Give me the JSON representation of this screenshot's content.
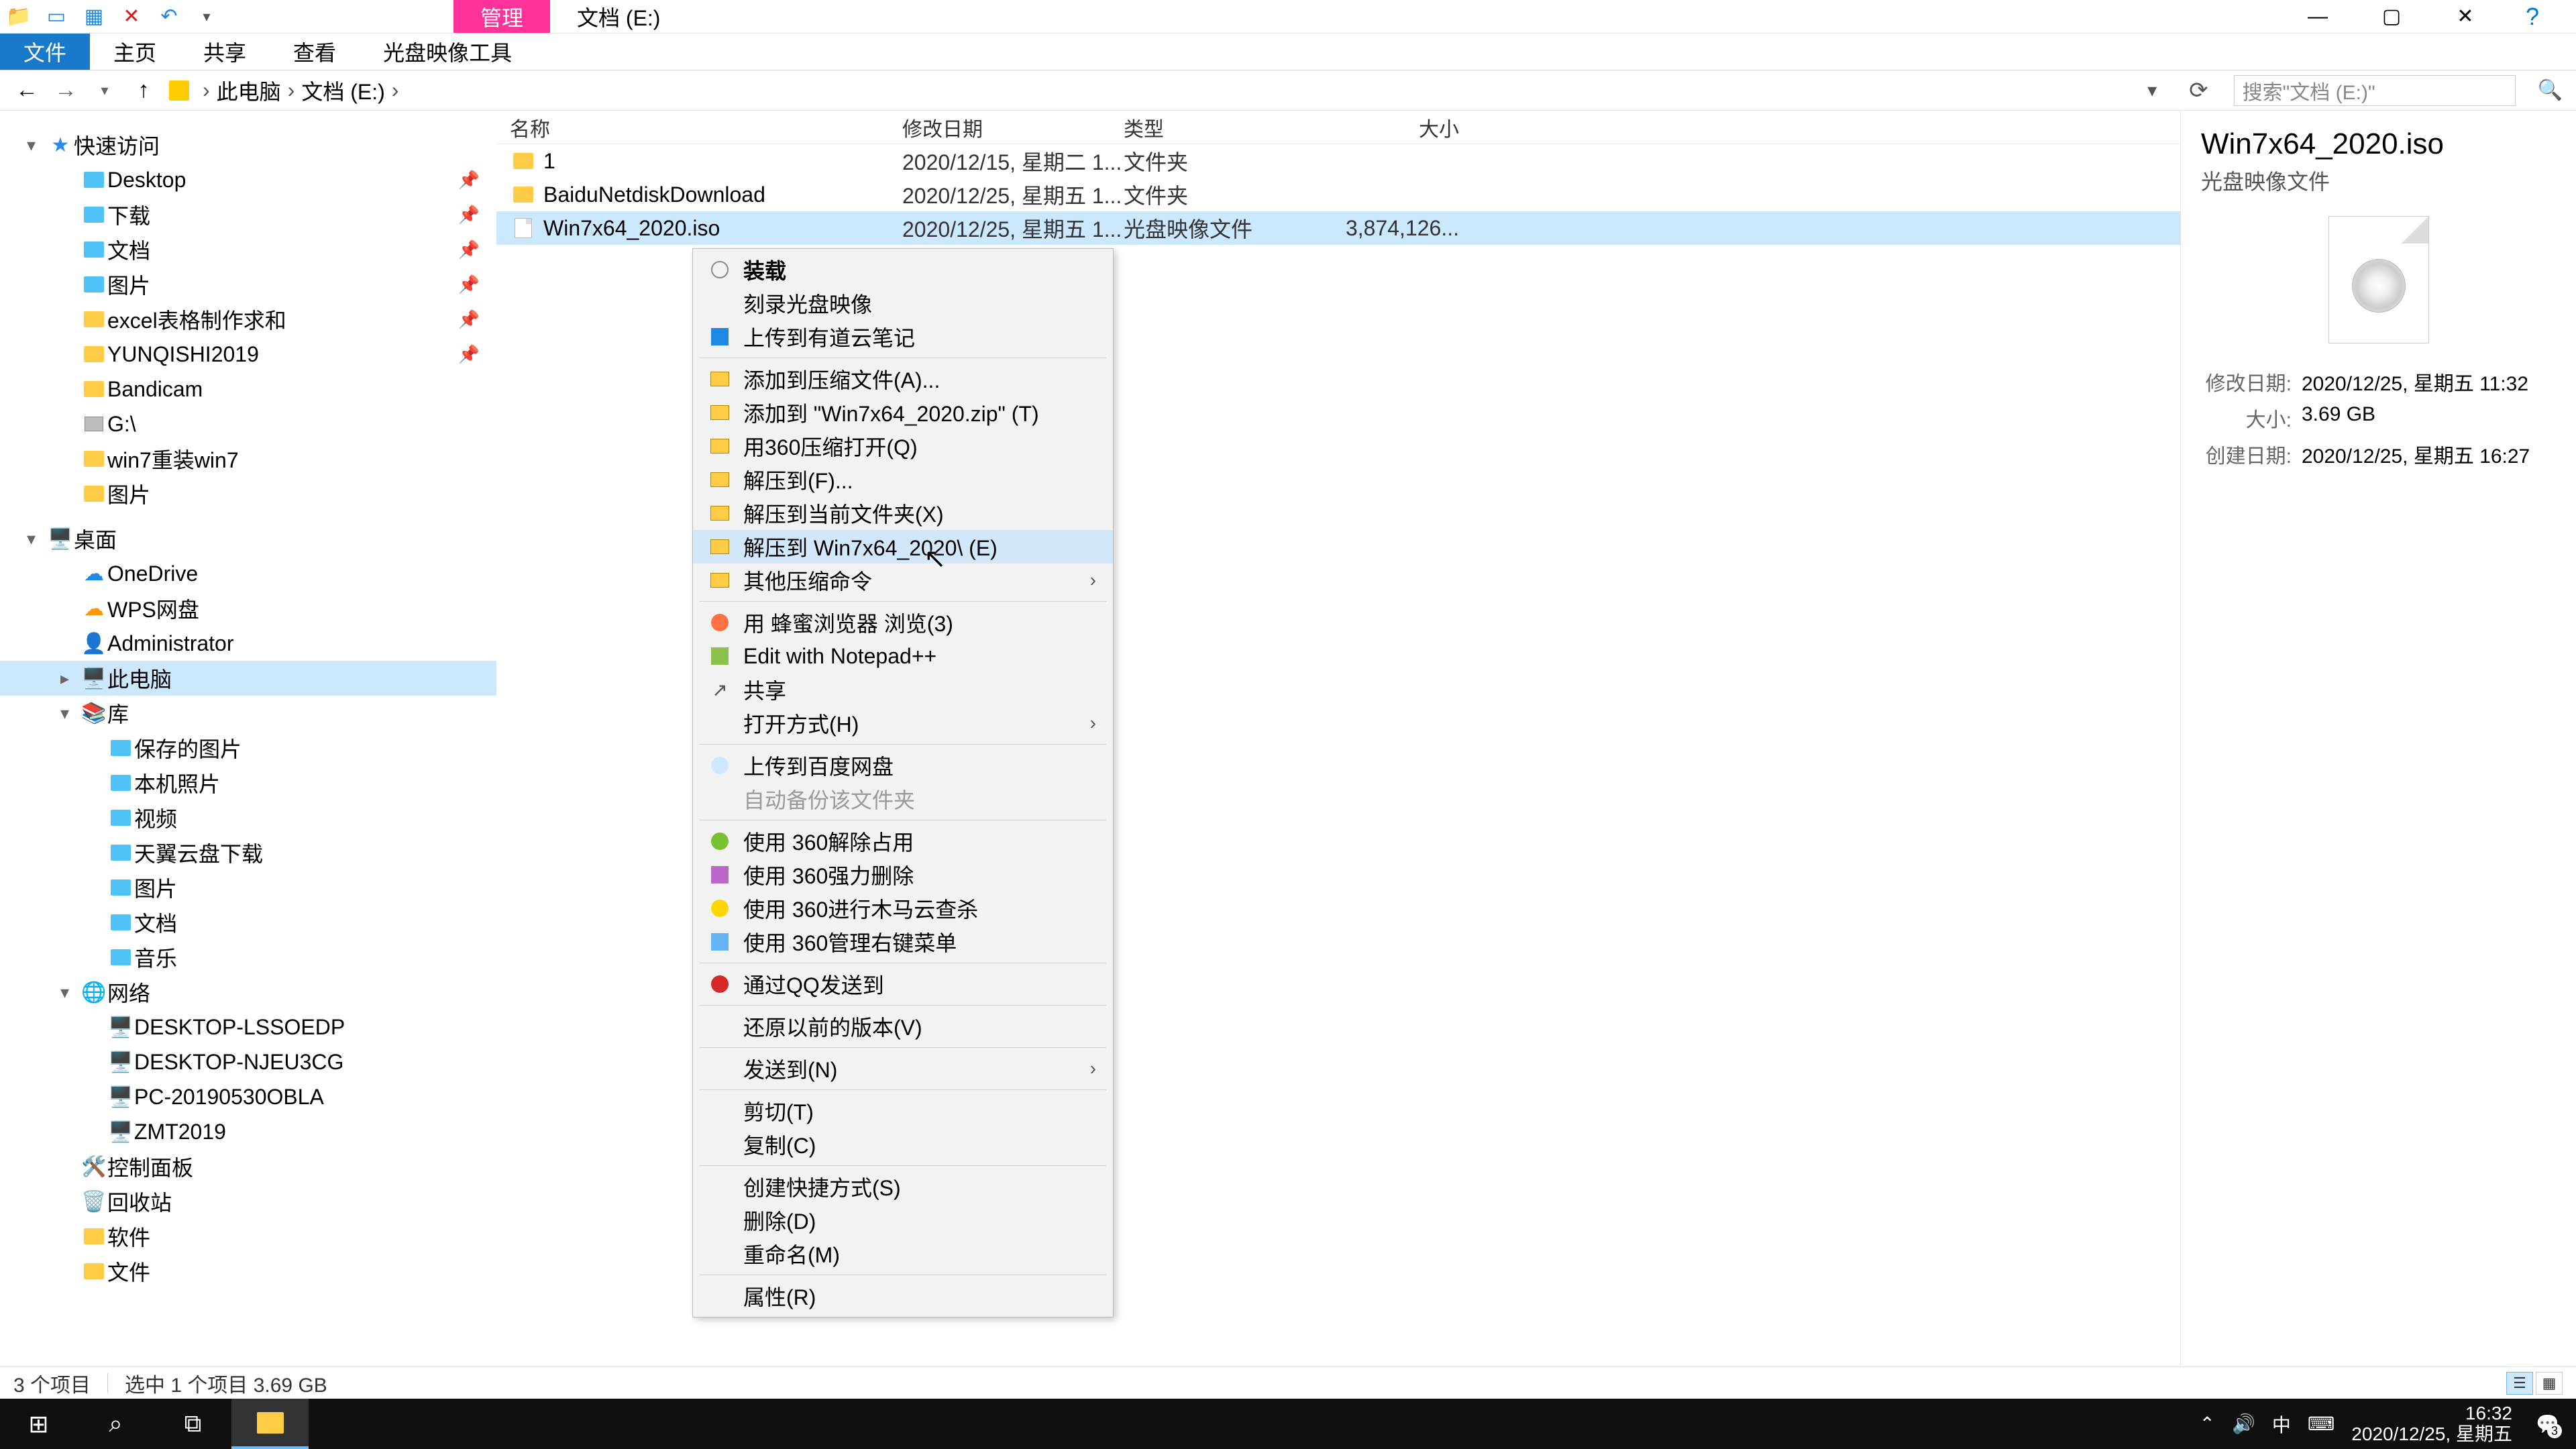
{
  "titlebar": {
    "tool_tab": "管理",
    "title": "文档 (E:)"
  },
  "ribbon": {
    "tabs": [
      "文件",
      "主页",
      "共享",
      "查看"
    ],
    "tool_tab": "光盘映像工具"
  },
  "breadcrumb": {
    "parts": [
      "此电脑",
      "文档 (E:)"
    ]
  },
  "search": {
    "placeholder": "搜索\"文档 (E:)\""
  },
  "tree": [
    {
      "lvl": 0,
      "section": true,
      "icon": "star",
      "label": "快速访问",
      "chev": "▾"
    },
    {
      "lvl": 1,
      "icon": "folder-blue",
      "label": "Desktop",
      "pin": true
    },
    {
      "lvl": 1,
      "icon": "folder-blue",
      "label": "下载",
      "pin": true
    },
    {
      "lvl": 1,
      "icon": "folder-blue",
      "label": "文档",
      "pin": true
    },
    {
      "lvl": 1,
      "icon": "folder-blue",
      "label": "图片",
      "pin": true
    },
    {
      "lvl": 1,
      "icon": "folder",
      "label": "excel表格制作求和",
      "pin": true
    },
    {
      "lvl": 1,
      "icon": "folder",
      "label": "YUNQISHI2019",
      "pin": true
    },
    {
      "lvl": 1,
      "icon": "folder",
      "label": "Bandicam"
    },
    {
      "lvl": 1,
      "icon": "hd",
      "label": "G:\\"
    },
    {
      "lvl": 1,
      "icon": "folder",
      "label": "win7重装win7"
    },
    {
      "lvl": 1,
      "icon": "folder",
      "label": "图片"
    },
    {
      "lvl": 0,
      "section": true,
      "icon": "desktop",
      "label": "桌面",
      "chev": "▾"
    },
    {
      "lvl": 1,
      "icon": "cloud",
      "label": "OneDrive"
    },
    {
      "lvl": 1,
      "icon": "cloud2",
      "label": "WPS网盘"
    },
    {
      "lvl": 1,
      "icon": "user",
      "label": "Administrator"
    },
    {
      "lvl": 1,
      "icon": "pc",
      "label": "此电脑",
      "selected": true,
      "chev": "▸"
    },
    {
      "lvl": 1,
      "icon": "lib",
      "label": "库",
      "chev": "▾"
    },
    {
      "lvl": 2,
      "icon": "folder-blue",
      "label": "保存的图片"
    },
    {
      "lvl": 2,
      "icon": "folder-blue",
      "label": "本机照片"
    },
    {
      "lvl": 2,
      "icon": "folder-blue",
      "label": "视频"
    },
    {
      "lvl": 2,
      "icon": "folder-blue",
      "label": "天翼云盘下载"
    },
    {
      "lvl": 2,
      "icon": "folder-blue",
      "label": "图片"
    },
    {
      "lvl": 2,
      "icon": "folder-blue",
      "label": "文档"
    },
    {
      "lvl": 2,
      "icon": "folder-blue",
      "label": "音乐"
    },
    {
      "lvl": 1,
      "icon": "net",
      "label": "网络",
      "chev": "▾"
    },
    {
      "lvl": 2,
      "icon": "pc",
      "label": "DESKTOP-LSSOEDP"
    },
    {
      "lvl": 2,
      "icon": "pc",
      "label": "DESKTOP-NJEU3CG"
    },
    {
      "lvl": 2,
      "icon": "pc",
      "label": "PC-20190530OBLA"
    },
    {
      "lvl": 2,
      "icon": "pc",
      "label": "ZMT2019"
    },
    {
      "lvl": 1,
      "icon": "panel",
      "label": "控制面板"
    },
    {
      "lvl": 1,
      "icon": "bin",
      "label": "回收站"
    },
    {
      "lvl": 1,
      "icon": "folder",
      "label": "软件"
    },
    {
      "lvl": 1,
      "icon": "folder",
      "label": "文件"
    }
  ],
  "columns": {
    "name": "名称",
    "date": "修改日期",
    "type": "类型",
    "size": "大小"
  },
  "files": [
    {
      "icon": "folder",
      "name": "1",
      "date": "2020/12/15, 星期二 1...",
      "type": "文件夹",
      "size": ""
    },
    {
      "icon": "folder",
      "name": "BaiduNetdiskDownload",
      "date": "2020/12/25, 星期五 1...",
      "type": "文件夹",
      "size": ""
    },
    {
      "icon": "iso",
      "name": "Win7x64_2020.iso",
      "date": "2020/12/25, 星期五 1...",
      "type": "光盘映像文件",
      "size": "3,874,126...",
      "selected": true
    }
  ],
  "ctx": [
    {
      "type": "item",
      "icon": "disc",
      "label": "装载",
      "bold": true
    },
    {
      "type": "item",
      "icon": "",
      "label": "刻录光盘映像"
    },
    {
      "type": "item",
      "icon": "note",
      "label": "上传到有道云笔记"
    },
    {
      "type": "sep"
    },
    {
      "type": "item",
      "icon": "archive",
      "label": "添加到压缩文件(A)..."
    },
    {
      "type": "item",
      "icon": "archive",
      "label": "添加到 \"Win7x64_2020.zip\" (T)"
    },
    {
      "type": "item",
      "icon": "archive",
      "label": "用360压缩打开(Q)"
    },
    {
      "type": "item",
      "icon": "archive",
      "label": "解压到(F)..."
    },
    {
      "type": "item",
      "icon": "archive",
      "label": "解压到当前文件夹(X)"
    },
    {
      "type": "item",
      "icon": "archive",
      "label": "解压到 Win7x64_2020\\ (E)",
      "hover": true
    },
    {
      "type": "item",
      "icon": "archive",
      "label": "其他压缩命令",
      "arrow": true
    },
    {
      "type": "sep"
    },
    {
      "type": "item",
      "icon": "honey",
      "label": "用 蜂蜜浏览器 浏览(3)"
    },
    {
      "type": "item",
      "icon": "npp",
      "label": "Edit with Notepad++"
    },
    {
      "type": "item",
      "icon": "share",
      "label": "共享"
    },
    {
      "type": "item",
      "icon": "",
      "label": "打开方式(H)",
      "arrow": true
    },
    {
      "type": "sep"
    },
    {
      "type": "item",
      "icon": "baidu",
      "label": "上传到百度网盘"
    },
    {
      "type": "item",
      "icon": "",
      "label": "自动备份该文件夹",
      "disabled": true
    },
    {
      "type": "sep"
    },
    {
      "type": "item",
      "icon": "360",
      "label": "使用 360解除占用"
    },
    {
      "type": "item",
      "icon": "360p",
      "label": "使用 360强力删除"
    },
    {
      "type": "item",
      "icon": "360y",
      "label": "使用 360进行木马云查杀"
    },
    {
      "type": "item",
      "icon": "360b",
      "label": "使用 360管理右键菜单"
    },
    {
      "type": "sep"
    },
    {
      "type": "item",
      "icon": "qq",
      "label": "通过QQ发送到"
    },
    {
      "type": "sep"
    },
    {
      "type": "item",
      "icon": "",
      "label": "还原以前的版本(V)"
    },
    {
      "type": "sep"
    },
    {
      "type": "item",
      "icon": "",
      "label": "发送到(N)",
      "arrow": true
    },
    {
      "type": "sep"
    },
    {
      "type": "item",
      "icon": "",
      "label": "剪切(T)"
    },
    {
      "type": "item",
      "icon": "",
      "label": "复制(C)"
    },
    {
      "type": "sep"
    },
    {
      "type": "item",
      "icon": "",
      "label": "创建快捷方式(S)"
    },
    {
      "type": "item",
      "icon": "",
      "label": "删除(D)"
    },
    {
      "type": "item",
      "icon": "",
      "label": "重命名(M)"
    },
    {
      "type": "sep"
    },
    {
      "type": "item",
      "icon": "",
      "label": "属性(R)"
    }
  ],
  "detail": {
    "title": "Win7x64_2020.iso",
    "subtitle": "光盘映像文件",
    "rows": [
      {
        "k": "修改日期:",
        "v": "2020/12/25, 星期五 11:32"
      },
      {
        "k": "大小:",
        "v": "3.69 GB"
      },
      {
        "k": "创建日期:",
        "v": "2020/12/25, 星期五 16:27"
      }
    ]
  },
  "status": {
    "count": "3 个项目",
    "selection": "选中 1 个项目  3.69 GB"
  },
  "taskbar": {
    "time": "16:32",
    "date": "2020/12/25, 星期五",
    "ime": "中",
    "notif_count": "3"
  }
}
